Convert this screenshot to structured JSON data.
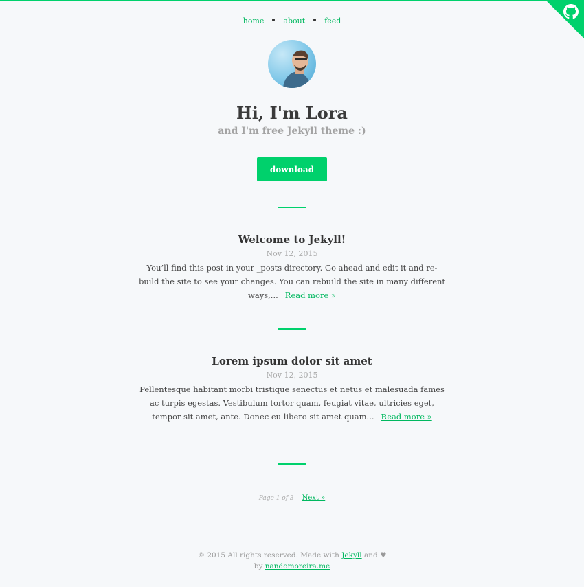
{
  "nav": {
    "items": [
      "home",
      "about",
      "feed"
    ]
  },
  "corner": {
    "icon": "github-icon",
    "color": "#00d16c"
  },
  "hero": {
    "avatar_icon": "avatar",
    "title": "Hi, I'm Lora",
    "subtitle": "and I'm free Jekyll theme :)",
    "button": "download"
  },
  "posts": [
    {
      "title": "Welcome to Jekyll!",
      "date": "Nov 12, 2015",
      "excerpt": "You’ll find this post in your _posts directory. Go ahead and edit it and re-build the site to see your changes. You can rebuild the site in many different ways,...",
      "more": "Read more »"
    },
    {
      "title": "Lorem ipsum dolor sit amet",
      "date": "Nov 12, 2015",
      "excerpt": "Pellentesque habitant morbi tristique senectus et netus et malesuada fames ac turpis egestas. Vestibulum tortor quam, feugiat vitae, ultricies eget, tempor sit amet, ante. Donec eu libero sit amet quam...",
      "more": "Read more »"
    }
  ],
  "pagination": {
    "info": "Page 1 of 3",
    "next": "Next »"
  },
  "footer": {
    "text1": "© 2015 All rights reserved. Made with",
    "link1": "Jekyll",
    "text2": "and ♥",
    "text3": "by",
    "link2": "nandomoreira.me"
  },
  "colors": {
    "accent": "#00d16c",
    "background": "#f6f8fa"
  }
}
